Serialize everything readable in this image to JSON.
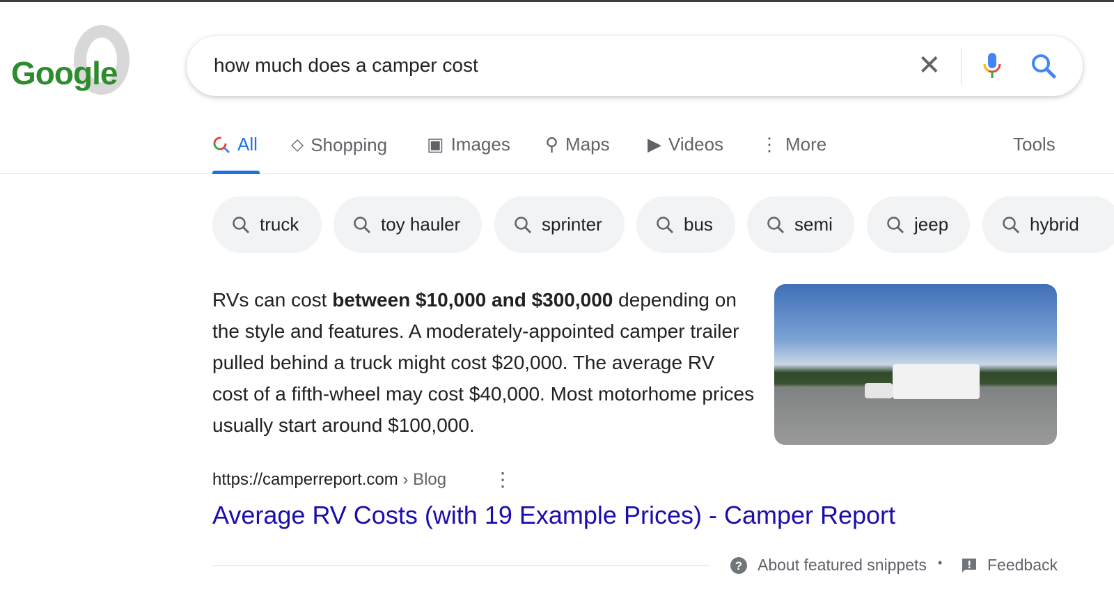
{
  "logo": {
    "text": "Google"
  },
  "search": {
    "query": "how much does a camper cost"
  },
  "tabs": [
    {
      "label": "All",
      "icon": "search-icon",
      "active": true
    },
    {
      "label": "Shopping",
      "icon": "tag-icon"
    },
    {
      "label": "Images",
      "icon": "image-icon"
    },
    {
      "label": "Maps",
      "icon": "map-pin-icon"
    },
    {
      "label": "Videos",
      "icon": "play-icon"
    },
    {
      "label": "More",
      "icon": "more-vert-icon"
    }
  ],
  "tools_label": "Tools",
  "chips": [
    "truck",
    "toy hauler",
    "sprinter",
    "bus",
    "semi",
    "jeep",
    "hybrid"
  ],
  "snippet": {
    "prefix": "RVs can cost ",
    "bold": "between $10,000 and $300,000",
    "suffix": " depending on the style and features. A moderately-appointed camper trailer pulled behind a truck might cost $20,000. The average RV cost of a fifth-wheel may cost $40,000. Most motorhome prices usually start around $100,000."
  },
  "result": {
    "url": "https://camperreport.com",
    "breadcrumb": " › Blog",
    "title": "Average RV Costs (with 19 Example Prices) - Camper Report"
  },
  "footer": {
    "about": "About featured snippets",
    "bullet": "•",
    "feedback": "Feedback"
  },
  "colors": {
    "accent": "#1a73e8",
    "link": "#1a0dab",
    "chip_bg": "#f1f3f4"
  }
}
